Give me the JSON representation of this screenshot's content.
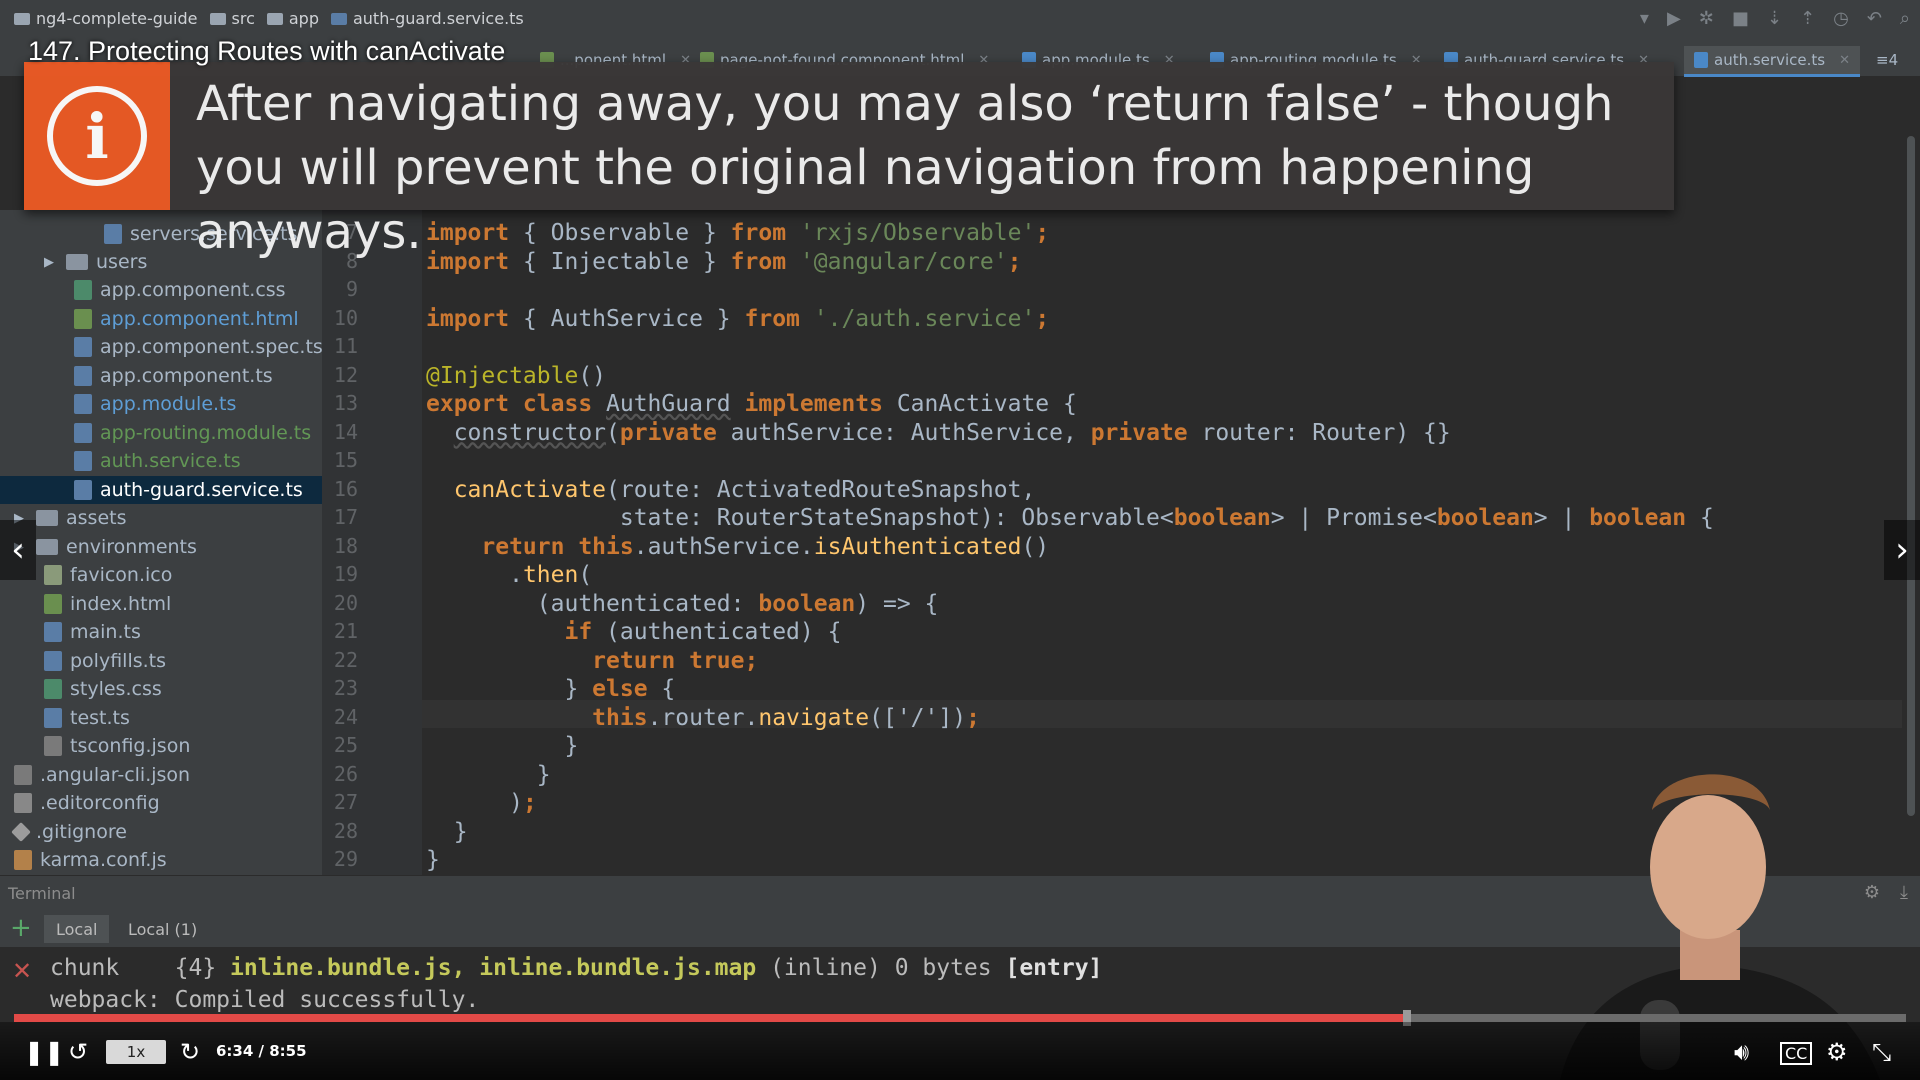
{
  "window": {
    "breadcrumbs": [
      "ng4-complete-guide",
      "src",
      "app",
      "auth-guard.service.ts"
    ]
  },
  "tabs": [
    {
      "label": "...ponent.html"
    },
    {
      "label": "page-not-found.component.html"
    },
    {
      "label": "app.module.ts"
    },
    {
      "label": "app-routing.module.ts"
    },
    {
      "label": "auth-guard.service.ts"
    },
    {
      "label": "auth.service.ts"
    },
    {
      "label": "≡4"
    }
  ],
  "course": {
    "lecture_title": "147. Protecting Routes with canActivate"
  },
  "notice": {
    "icon": "info-icon",
    "text": "After navigating away, you may also ‘return false’ - though you will prevent the original navigation from happening anyways."
  },
  "project_tree": {
    "items": [
      {
        "label": "servers.service.ts",
        "type": "ts",
        "color": "#a9b7c6"
      },
      {
        "label": "users",
        "type": "folder",
        "color": "#a9b7c6"
      },
      {
        "label": "app.component.css",
        "type": "css",
        "color": "#a9b7c6"
      },
      {
        "label": "app.component.html",
        "type": "html",
        "color": "#5e9ed6"
      },
      {
        "label": "app.component.spec.ts",
        "type": "ts",
        "color": "#a9b7c6"
      },
      {
        "label": "app.component.ts",
        "type": "ts",
        "color": "#a9b7c6"
      },
      {
        "label": "app.module.ts",
        "type": "ts",
        "color": "#5e9ed6"
      },
      {
        "label": "app-routing.module.ts",
        "type": "ts",
        "color": "#629755"
      },
      {
        "label": "auth.service.ts",
        "type": "ts",
        "color": "#629755"
      },
      {
        "label": "auth-guard.service.ts",
        "type": "ts",
        "color": "#ffffff"
      },
      {
        "label": "assets",
        "type": "folder",
        "color": "#a9b7c6"
      },
      {
        "label": "environments",
        "type": "folder",
        "color": "#a9b7c6"
      },
      {
        "label": "favicon.ico",
        "type": "ico",
        "color": "#a9b7c6"
      },
      {
        "label": "index.html",
        "type": "html",
        "color": "#a9b7c6"
      },
      {
        "label": "main.ts",
        "type": "ts",
        "color": "#a9b7c6"
      },
      {
        "label": "polyfills.ts",
        "type": "ts",
        "color": "#a9b7c6"
      },
      {
        "label": "styles.css",
        "type": "css",
        "color": "#a9b7c6"
      },
      {
        "label": "test.ts",
        "type": "ts",
        "color": "#a9b7c6"
      },
      {
        "label": "tsconfig.json",
        "type": "json",
        "color": "#a9b7c6"
      },
      {
        "label": ".angular-cli.json",
        "type": "json",
        "color": "#a9b7c6"
      },
      {
        "label": ".editorconfig",
        "type": "cfg",
        "color": "#a9b7c6"
      },
      {
        "label": ".gitignore",
        "type": "git",
        "color": "#a9b7c6"
      },
      {
        "label": "karma.conf.js",
        "type": "js",
        "color": "#a9b7c6"
      }
    ]
  },
  "editor": {
    "line_numbers": [
      "7",
      "8",
      "9",
      "10",
      "11",
      "12",
      "13",
      "14",
      "15",
      "16",
      "17",
      "18",
      "19",
      "20",
      "21",
      "22",
      "23",
      "24",
      "25",
      "26",
      "27",
      "28",
      "29"
    ],
    "lines": [
      [
        {
          "t": "import",
          "c": "kw"
        },
        {
          "t": " { Observable } "
        },
        {
          "t": "from",
          "c": "kw"
        },
        {
          "t": " "
        },
        {
          "t": "'rxjs/Observable'",
          "c": "str"
        },
        {
          "t": ";",
          "c": "kw"
        }
      ],
      [
        {
          "t": "import",
          "c": "kw"
        },
        {
          "t": " { Injectable } "
        },
        {
          "t": "from",
          "c": "kw"
        },
        {
          "t": " "
        },
        {
          "t": "'@angular/core'",
          "c": "str"
        },
        {
          "t": ";",
          "c": "kw"
        }
      ],
      [],
      [
        {
          "t": "import",
          "c": "kw"
        },
        {
          "t": " { AuthService } "
        },
        {
          "t": "from",
          "c": "kw"
        },
        {
          "t": " "
        },
        {
          "t": "'./auth.service'",
          "c": "str"
        },
        {
          "t": ";",
          "c": "kw"
        }
      ],
      [],
      [
        {
          "t": "@Injectable",
          "c": "ann"
        },
        {
          "t": "()"
        }
      ],
      [
        {
          "t": "export class ",
          "c": "kw"
        },
        {
          "t": "AuthGuard",
          "c": "cls"
        },
        {
          "t": " "
        },
        {
          "t": "implements",
          "c": "kw"
        },
        {
          "t": " CanActivate {"
        }
      ],
      [
        {
          "t": "  "
        },
        {
          "t": "constructor",
          "c": "cls"
        },
        {
          "t": "("
        },
        {
          "t": "private",
          "c": "kw"
        },
        {
          "t": " authService: AuthService, "
        },
        {
          "t": "private",
          "c": "kw"
        },
        {
          "t": " router: Router) {}"
        }
      ],
      [],
      [
        {
          "t": "  "
        },
        {
          "t": "canActivate",
          "c": "fn"
        },
        {
          "t": "(route: ActivatedRouteSnapshot,"
        }
      ],
      [
        {
          "t": "              state: RouterStateSnapshot): Observable<"
        },
        {
          "t": "boolean",
          "c": "kw"
        },
        {
          "t": "> | Promise<"
        },
        {
          "t": "boolean",
          "c": "kw"
        },
        {
          "t": "> | "
        },
        {
          "t": "boolean",
          "c": "kw"
        },
        {
          "t": " {"
        }
      ],
      [
        {
          "t": "    "
        },
        {
          "t": "return this",
          "c": "kw"
        },
        {
          "t": ".authService."
        },
        {
          "t": "isAuthenticated",
          "c": "fn"
        },
        {
          "t": "()"
        }
      ],
      [
        {
          "t": "      ."
        },
        {
          "t": "then",
          "c": "fn"
        },
        {
          "t": "("
        }
      ],
      [
        {
          "t": "        (authenticated: "
        },
        {
          "t": "boolean",
          "c": "kw"
        },
        {
          "t": ") => {"
        }
      ],
      [
        {
          "t": "          "
        },
        {
          "t": "if",
          "c": "kw"
        },
        {
          "t": " (authenticated) {"
        }
      ],
      [
        {
          "t": "            "
        },
        {
          "t": "return true",
          "c": "kw"
        },
        {
          "t": ";",
          "c": "kw"
        }
      ],
      [
        {
          "t": "          } "
        },
        {
          "t": "else",
          "c": "kw"
        },
        {
          "t": " {"
        }
      ],
      [
        {
          "t": "            "
        },
        {
          "t": "this",
          "c": "kw"
        },
        {
          "t": ".router."
        },
        {
          "t": "navigate",
          "c": "fn"
        },
        {
          "t": "(['/'])"
        },
        {
          "t": ";",
          "c": "kw"
        }
      ],
      [
        {
          "t": "          }"
        }
      ],
      [
        {
          "t": "        }"
        }
      ],
      [
        {
          "t": "      )"
        },
        {
          "t": ";",
          "c": "kw"
        }
      ],
      [
        {
          "t": "  }"
        }
      ],
      [
        {
          "t": "}"
        }
      ]
    ]
  },
  "terminal": {
    "title": "Terminal",
    "tabs": [
      "Local",
      "Local (1)"
    ],
    "line1": {
      "a": "chunk    {4} ",
      "b": "inline.bundle.js, inline.bundle.js.map",
      "c": " (inline) 0 bytes ",
      "d": "[entry]"
    },
    "line2": "webpack: Compiled successfully."
  },
  "player": {
    "speed": "1x",
    "time": "6:34 / 8:55",
    "progress": 0.736,
    "buffered": 0.998,
    "icons": [
      "pause-icon",
      "rewind-icon",
      "forward-icon",
      "volume-icon",
      "cc-icon",
      "settings-icon",
      "fullscreen-exit-icon"
    ]
  },
  "colors": {
    "accent_orange": "#ec5a24",
    "progress_red": "#e24a47",
    "editor_bg": "#2b2b2b"
  }
}
